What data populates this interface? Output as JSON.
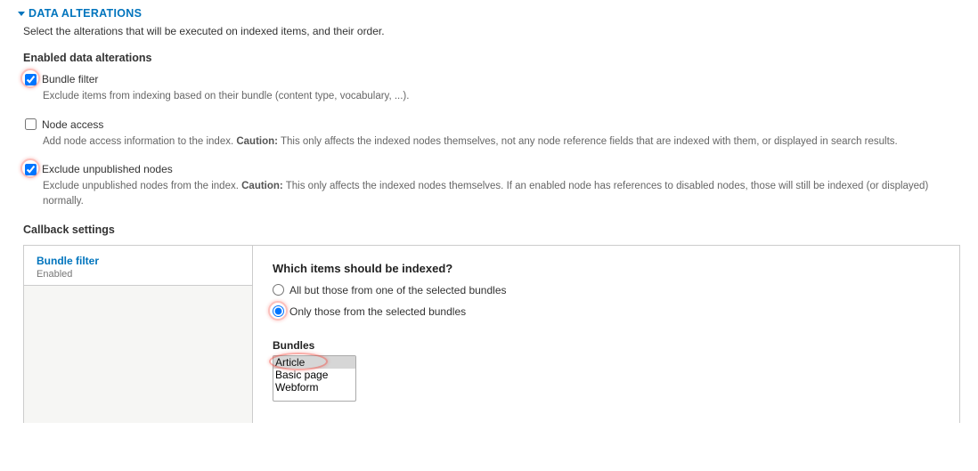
{
  "section": {
    "title": "DATA ALTERATIONS",
    "description": "Select the alterations that will be executed on indexed items, and their order."
  },
  "enabled": {
    "title": "Enabled data alterations",
    "items": [
      {
        "label": "Bundle filter",
        "checked": true,
        "highlighted": true,
        "desc_pre": "Exclude items from indexing based on their bundle (content type, vocabulary, ...).",
        "desc_bold": "",
        "desc_post": ""
      },
      {
        "label": "Node access",
        "checked": false,
        "highlighted": false,
        "desc_pre": "Add node access information to the index. ",
        "desc_bold": "Caution:",
        "desc_post": " This only affects the indexed nodes themselves, not any node reference fields that are indexed with them, or displayed in search results."
      },
      {
        "label": "Exclude unpublished nodes",
        "checked": true,
        "highlighted": true,
        "desc_pre": "Exclude unpublished nodes from the index. ",
        "desc_bold": "Caution:",
        "desc_post": " This only affects the indexed nodes themselves. If an enabled node has references to disabled nodes, those will still be indexed (or displayed) normally."
      }
    ]
  },
  "callback": {
    "title": "Callback settings",
    "tab": {
      "title": "Bundle filter",
      "status": "Enabled"
    },
    "which": {
      "title": "Which items should be indexed?",
      "options": [
        {
          "label": "All but those from one of the selected bundles",
          "checked": false,
          "highlighted": false
        },
        {
          "label": "Only those from the selected bundles",
          "checked": true,
          "highlighted": true
        }
      ]
    },
    "bundles": {
      "title": "Bundles",
      "options": [
        {
          "label": "Article",
          "selected": true,
          "highlighted": true
        },
        {
          "label": "Basic page",
          "selected": false,
          "highlighted": false
        },
        {
          "label": "Webform",
          "selected": false,
          "highlighted": false
        }
      ]
    }
  }
}
